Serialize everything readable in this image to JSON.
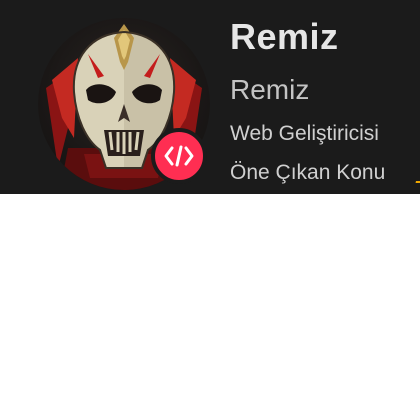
{
  "profile": {
    "username": "Remiz",
    "display_name": "Remiz",
    "role": "Web Geliştiricisi",
    "featured_label": "Öne Çıkan Konu",
    "featured_link": "_"
  },
  "avatar": {
    "icon": "skull-mask-icon",
    "badge_icon": "code-brackets-icon"
  },
  "colors": {
    "card_background": "#1b1b1b",
    "badge": "#ff2e52",
    "text_primary": "#e6e6e6",
    "text_secondary": "#c4c4c4",
    "link": "#f0a800"
  }
}
